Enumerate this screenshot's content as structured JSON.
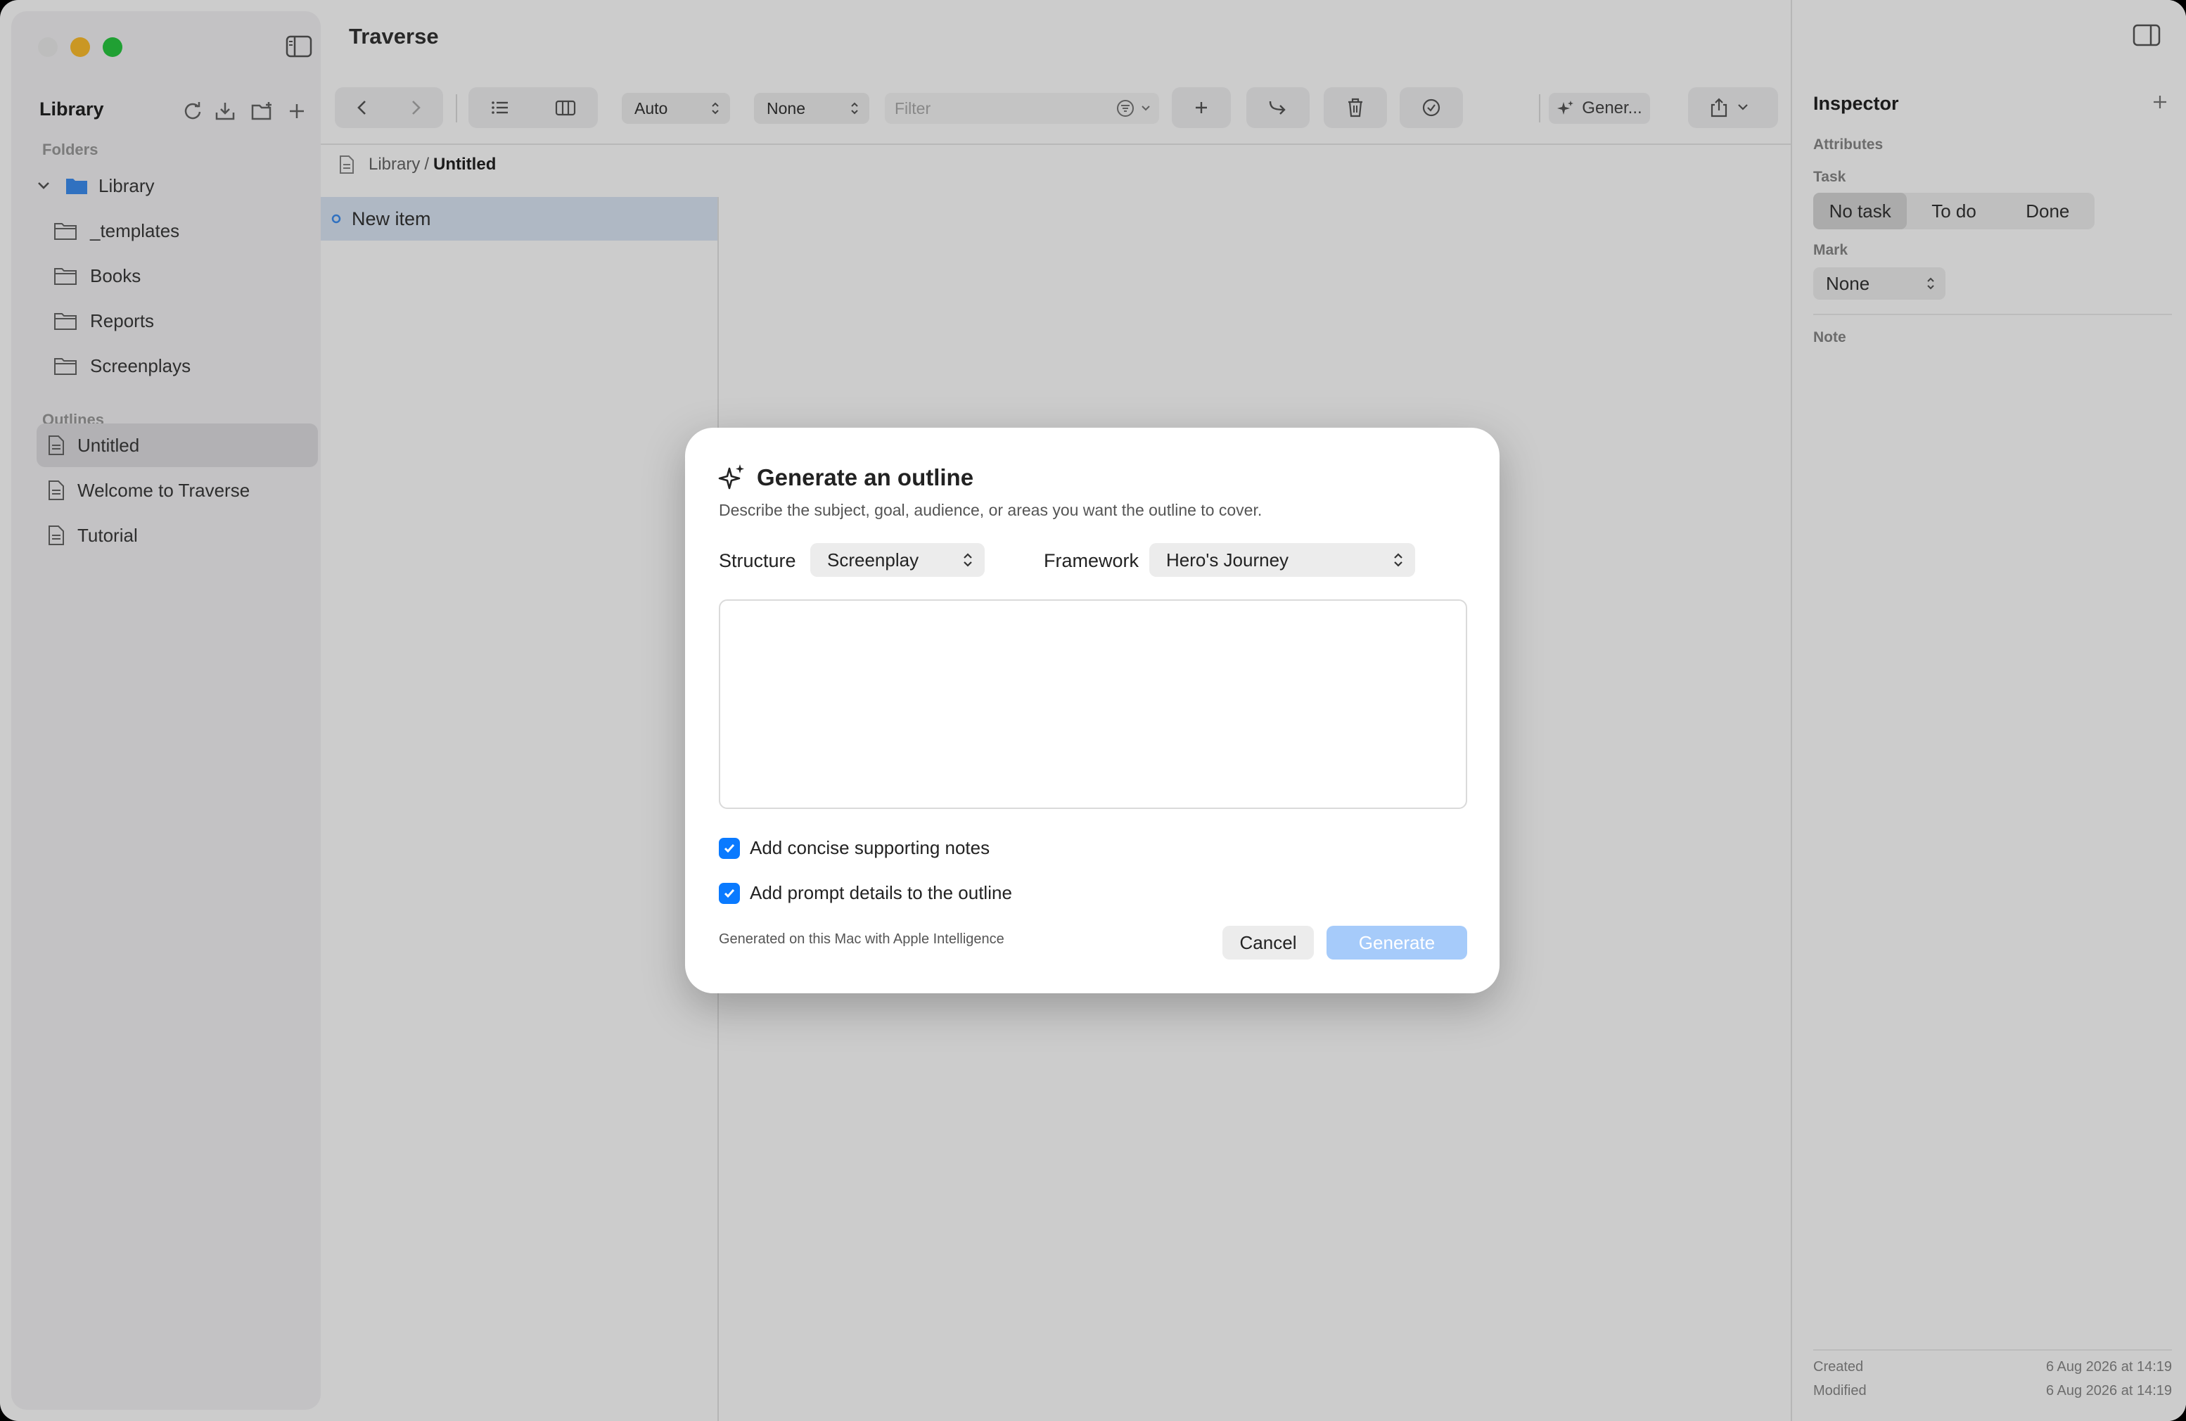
{
  "app": {
    "title": "Traverse"
  },
  "sidebar": {
    "title": "Library",
    "folders_label": "Folders",
    "folders": [
      {
        "label": "Library",
        "expanded": true
      },
      {
        "label": "_templates"
      },
      {
        "label": "Books"
      },
      {
        "label": "Reports"
      },
      {
        "label": "Screenplays"
      }
    ],
    "outlines_label": "Outlines",
    "outlines": [
      {
        "label": "Untitled",
        "selected": true
      },
      {
        "label": "Welcome to Traverse"
      },
      {
        "label": "Tutorial"
      }
    ]
  },
  "toolbar": {
    "auto_select": "Auto",
    "none_select": "None",
    "filter_placeholder": "Filter",
    "generate_label": "Gener..."
  },
  "breadcrumb": {
    "root": "Library",
    "separator": "/",
    "current": "Untitled"
  },
  "outline": {
    "items": [
      {
        "label": "New item"
      }
    ]
  },
  "inspector": {
    "title": "Inspector",
    "attributes_label": "Attributes",
    "task_label": "Task",
    "task_options": [
      "No task",
      "To do",
      "Done"
    ],
    "task_selected": "No task",
    "mark_label": "Mark",
    "mark_value": "None",
    "note_label": "Note",
    "created_label": "Created",
    "created_value": "6 Aug 2026 at 14:19",
    "modified_label": "Modified",
    "modified_value": "6 Aug 2026 at 14:19"
  },
  "dialog": {
    "title": "Generate an outline",
    "subtitle": "Describe the subject, goal, audience, or areas you want the outline to cover.",
    "structure_label": "Structure",
    "structure_value": "Screenplay",
    "framework_label": "Framework",
    "framework_value": "Hero's Journey",
    "prompt_value": "",
    "checkbox1_label": "Add concise supporting notes",
    "checkbox1_checked": true,
    "checkbox2_label": "Add prompt details to the outline",
    "checkbox2_checked": true,
    "footnote": "Generated on this Mac with Apple Intelligence",
    "cancel_label": "Cancel",
    "generate_label": "Generate"
  },
  "colors": {
    "accent": "#0a7aff",
    "folder": "#3d8ef0",
    "generate_disabled": "#a6cbfa"
  }
}
